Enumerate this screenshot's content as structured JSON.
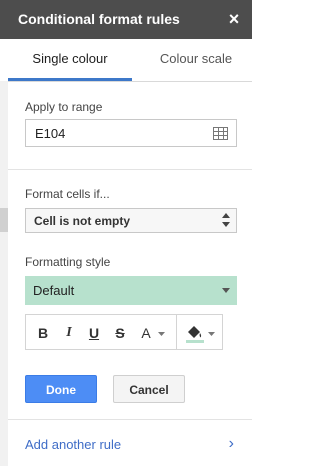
{
  "header": {
    "title": "Conditional format rules",
    "close_glyph": "×"
  },
  "tabs": [
    {
      "label": "Single colour",
      "active": true
    },
    {
      "label": "Colour scale",
      "active": false
    }
  ],
  "range": {
    "label": "Apply to range",
    "value": "E104",
    "icon": "grid-select-icon"
  },
  "condition": {
    "label": "Format cells if...",
    "selected": "Cell is not empty"
  },
  "formatting": {
    "label": "Formatting style",
    "selected": "Default",
    "preview_color": "#b7e1cd",
    "toolbar": {
      "bold": "B",
      "italic": "I",
      "underline": "U",
      "strikethrough": "S",
      "text_color": "A",
      "fill_icon": "paint-bucket-icon"
    }
  },
  "actions": {
    "done": "Done",
    "cancel": "Cancel"
  },
  "footer": {
    "add_rule": "Add another rule",
    "chevron": "›"
  },
  "colors": {
    "header_bg": "#4d4d4d",
    "accent": "#4d8df5",
    "link": "#3f6dc7",
    "fill_swatch": "#b7e1cd"
  }
}
